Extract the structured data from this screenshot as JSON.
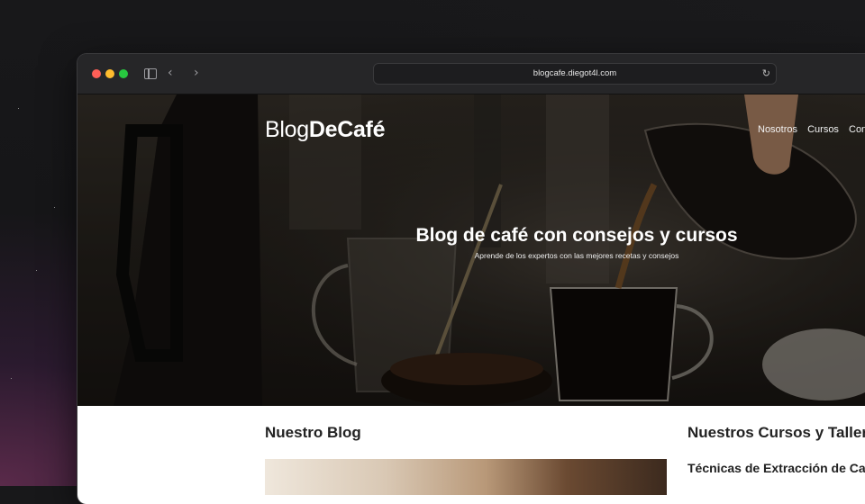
{
  "browser": {
    "url": "blogcafe.diegot4l.com",
    "colors": {
      "close": "#ff5f57",
      "minimize": "#febc2e",
      "maximize": "#28c840"
    }
  },
  "site": {
    "logo_light": "Blog",
    "logo_bold": "DeCafé",
    "nav": [
      "Nosotros",
      "Cursos",
      "Con"
    ]
  },
  "hero": {
    "title": "Blog de café con consejos y cursos",
    "subtitle": "Aprende de los expertos con las mejores recetas y consejos"
  },
  "main": {
    "blog_heading": "Nuestro Blog",
    "courses_heading": "Nuestros Cursos y Tallere",
    "course_title": "Técnicas de Extracción de Ca"
  }
}
